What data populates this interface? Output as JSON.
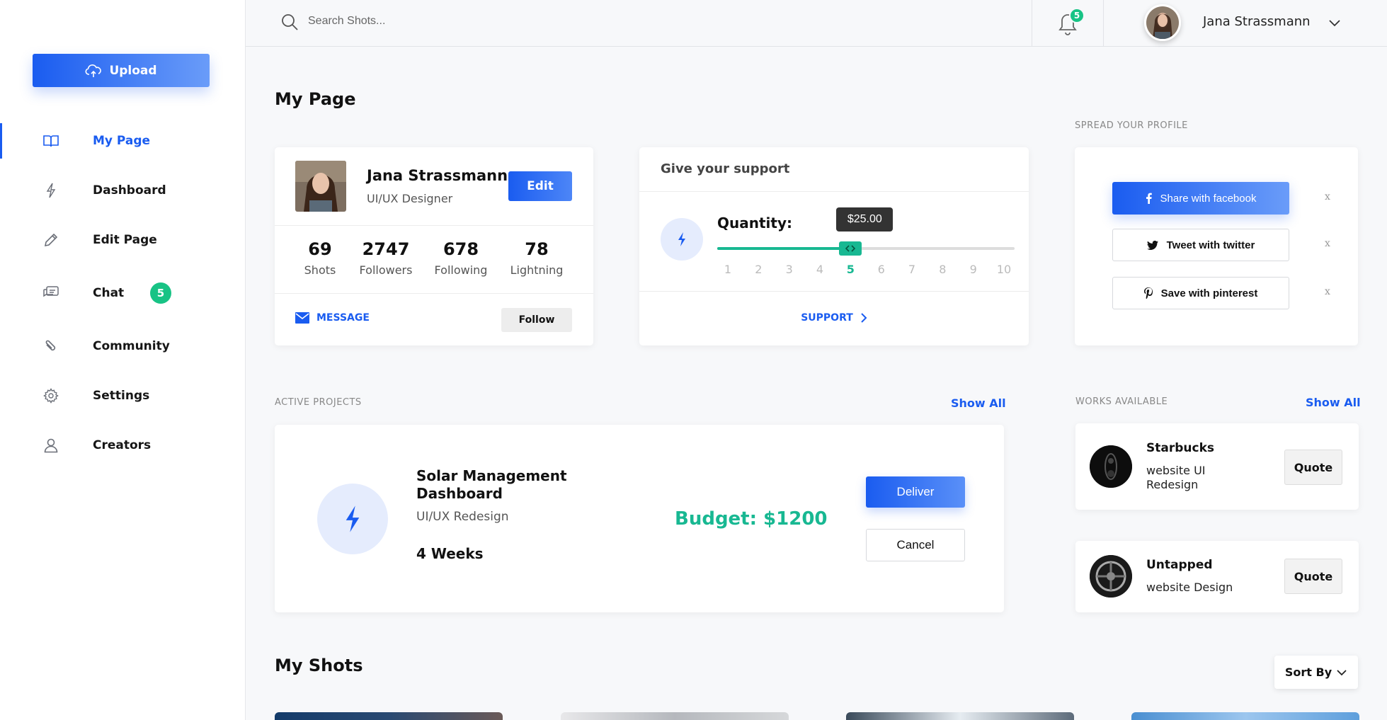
{
  "colors": {
    "accent": "#1a5cf0",
    "success": "#18c385",
    "budget": "#18b892"
  },
  "sidebar": {
    "upload_label": "Upload",
    "items": [
      {
        "label": "My Page",
        "icon": "book-icon",
        "active": true
      },
      {
        "label": "Dashboard",
        "icon": "bolt-icon"
      },
      {
        "label": "Edit Page",
        "icon": "pencil-icon"
      },
      {
        "label": "Chat",
        "icon": "chat-icon",
        "badge": "5"
      },
      {
        "label": "Community",
        "icon": "paperclip-icon"
      },
      {
        "label": "Settings",
        "icon": "gear-icon"
      },
      {
        "label": "Creators",
        "icon": "user-icon"
      }
    ]
  },
  "topbar": {
    "search_placeholder": "Search Shots...",
    "notification_count": "5",
    "username": "Jana Strassmann"
  },
  "main": {
    "title": "My Page",
    "profile": {
      "name": "Jana Strassmann",
      "role": "UI/UX Designer",
      "edit_label": "Edit",
      "stats": [
        {
          "value": "69",
          "label": "Shots"
        },
        {
          "value": "2747",
          "label": "Followers"
        },
        {
          "value": "678",
          "label": "Following"
        },
        {
          "value": "78",
          "label": "Lightning"
        }
      ],
      "message_label": "MESSAGE",
      "follow_label": "Follow"
    },
    "support": {
      "title": "Give your support",
      "quantity_label": "Quantity:",
      "amount": "$25.00",
      "ticks": [
        "1",
        "2",
        "3",
        "4",
        "5",
        "6",
        "7",
        "8",
        "9",
        "10"
      ],
      "selected": 5,
      "min": 1,
      "max": 10,
      "support_label": "SUPPORT"
    },
    "spread": {
      "label": "SPREAD YOUR PROFILE",
      "buttons": [
        {
          "label": "Share with facebook",
          "icon": "facebook-icon"
        },
        {
          "label": "Tweet with twitter",
          "icon": "twitter-icon"
        },
        {
          "label": "Save with pinterest",
          "icon": "pinterest-icon"
        }
      ],
      "close_label": "x"
    },
    "active_projects": {
      "label": "ACTIVE PROJECTS",
      "show_all": "Show All",
      "project": {
        "title": "Solar Management Dashboard",
        "subtitle": "UI/UX Redesign",
        "duration": "4 Weeks",
        "budget": "Budget: $1200",
        "deliver_label": "Deliver",
        "cancel_label": "Cancel"
      }
    },
    "works": {
      "label": "WORKS AVAILABLE",
      "show_all": "Show All",
      "items": [
        {
          "name": "Starbucks",
          "desc": "website UI Redesign",
          "quote": "Quote"
        },
        {
          "name": "Untapped",
          "desc": "website Design",
          "quote": "Quote"
        }
      ]
    },
    "shots": {
      "title": "My Shots",
      "sort_label": "Sort By"
    }
  }
}
